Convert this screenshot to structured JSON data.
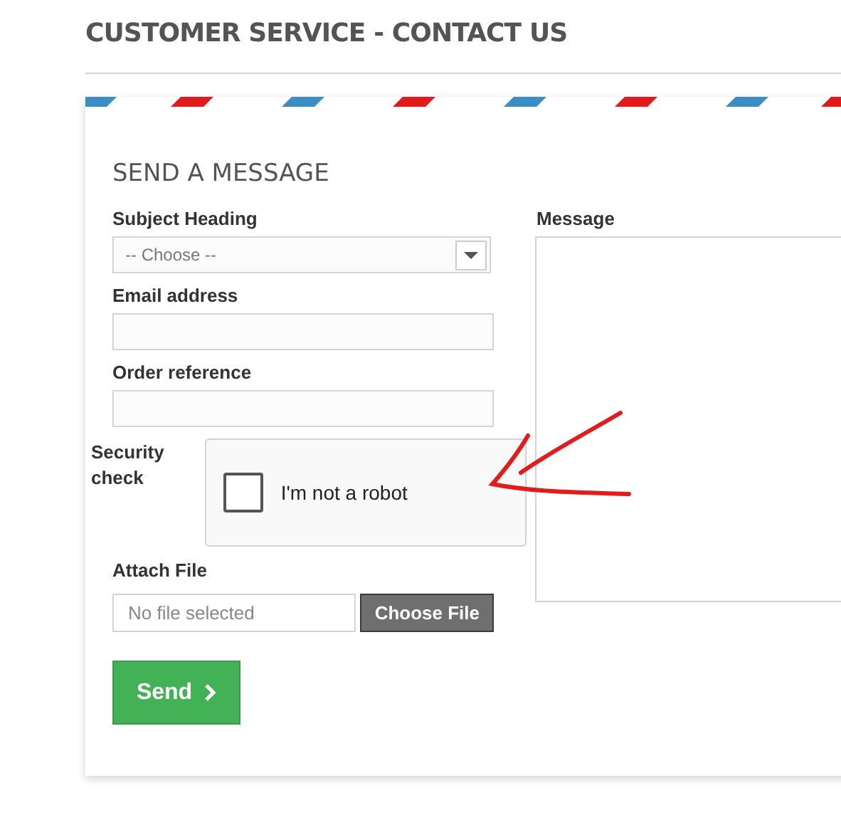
{
  "page_title": "CUSTOMER SERVICE - CONTACT US",
  "form": {
    "title": "SEND A MESSAGE",
    "subject": {
      "label": "Subject Heading",
      "value": "-- Choose --"
    },
    "email": {
      "label": "Email address"
    },
    "order": {
      "label": "Order reference"
    },
    "security": {
      "label": "Security check",
      "captcha_label": "I'm not a robot",
      "checked": false
    },
    "attach": {
      "label": "Attach File",
      "file_text": "No file selected",
      "button": "Choose File"
    },
    "send": {
      "label": "Send"
    },
    "message": {
      "label": "Message"
    }
  }
}
